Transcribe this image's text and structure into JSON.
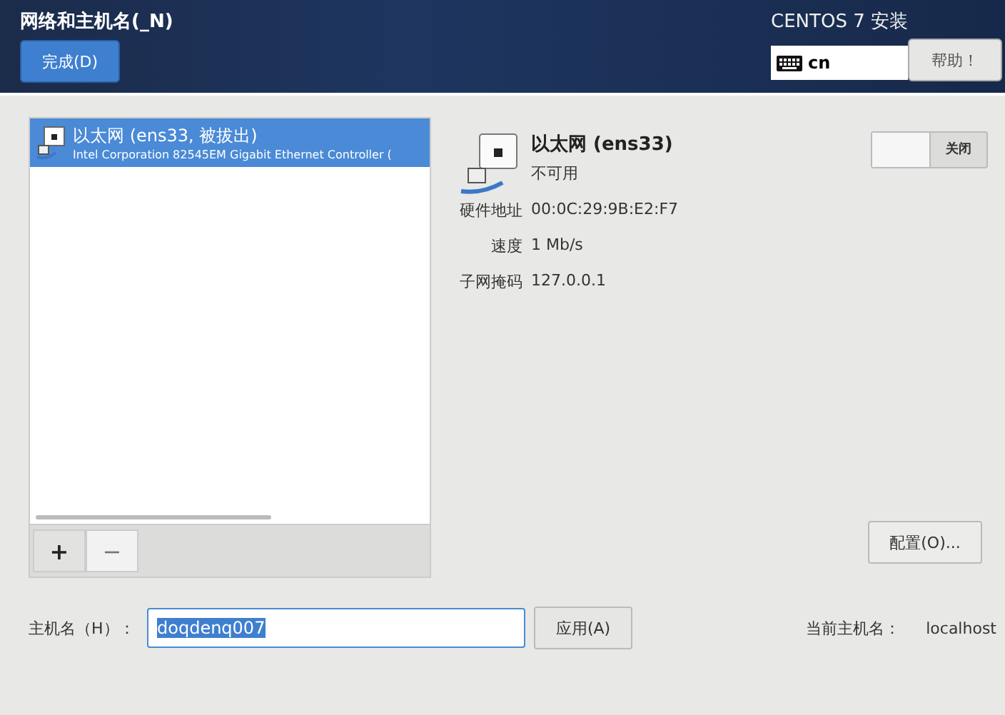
{
  "header": {
    "title": "网络和主机名(_N)",
    "done_button": "完成(D)",
    "product": "CENTOS 7 安装",
    "keyboard": "cn",
    "help_button": "帮助！"
  },
  "devices": [
    {
      "name": "以太网 (ens33, 被拔出)",
      "description": "Intel Corporation 82545EM Gigabit Ethernet Controller (",
      "selected": true
    }
  ],
  "list_buttons": [
    "+",
    "−"
  ],
  "detail": {
    "name": "以太网 (ens33)",
    "status": "不可用",
    "toggle": {
      "label": "关闭",
      "on": false
    },
    "properties": [
      {
        "label": "硬件地址",
        "value": "00:0C:29:9B:E2:F7"
      },
      {
        "label": "速度",
        "value": "1 Mb/s"
      },
      {
        "label": "子网掩码",
        "value": "127.0.0.1"
      }
    ],
    "configure_button": "配置(O)..."
  },
  "hostname": {
    "label": "主机名（H）：",
    "value": "doqdenq007",
    "apply_button": "应用(A)",
    "current_label": "当前主机名：",
    "current_value": "localhost"
  }
}
